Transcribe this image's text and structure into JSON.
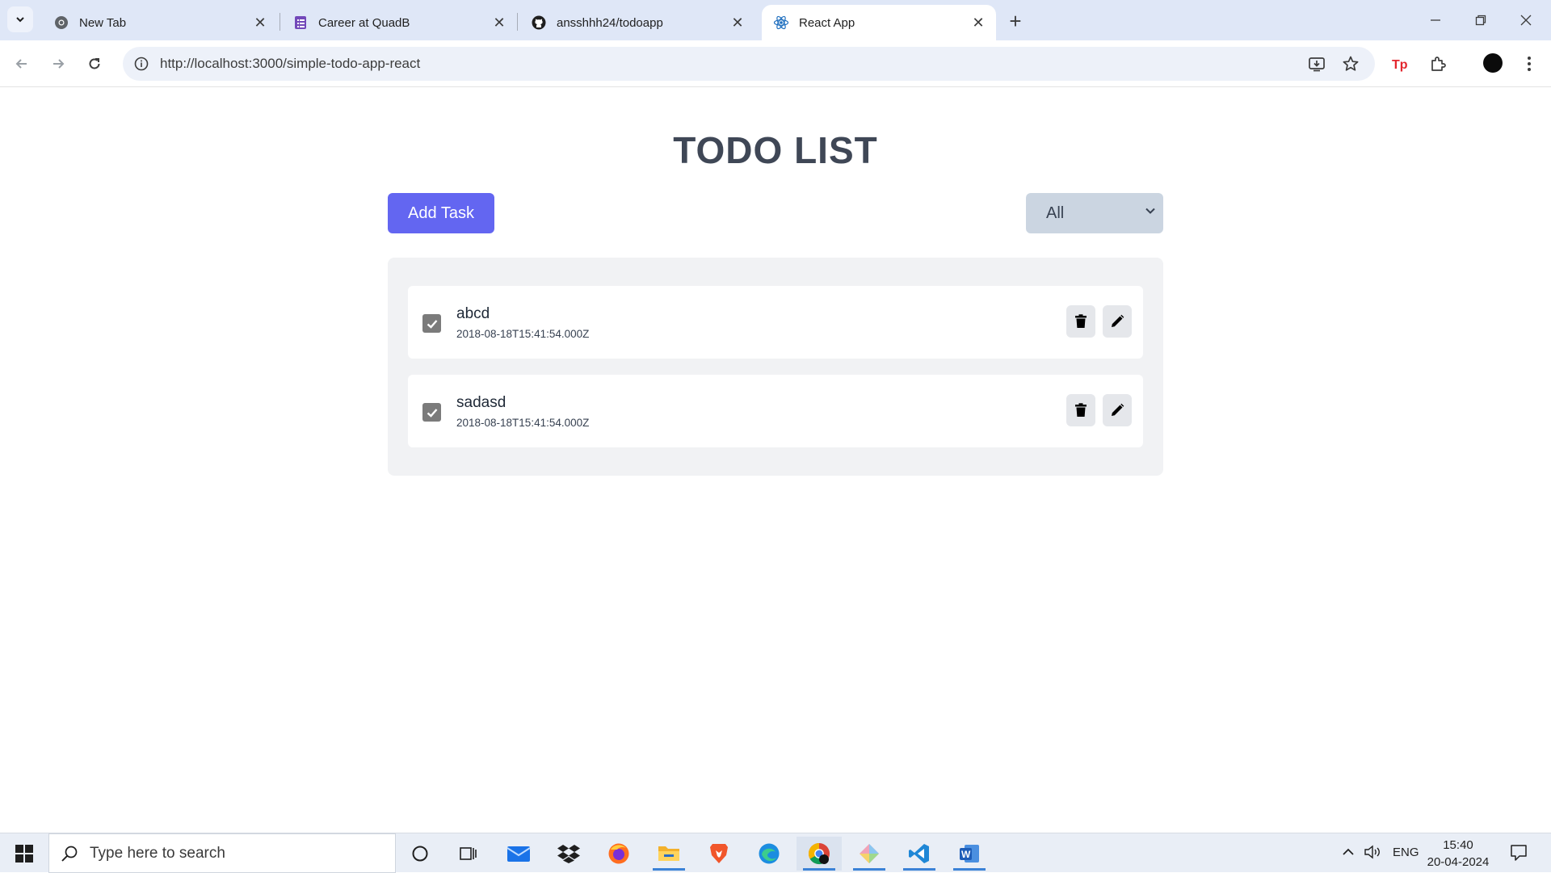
{
  "browser": {
    "tabs": [
      {
        "title": "New Tab",
        "favicon": "chrome-icon",
        "active": false
      },
      {
        "title": "Career at QuadB",
        "favicon": "forms-icon",
        "active": false
      },
      {
        "title": "ansshhh24/todoapp",
        "favicon": "github-icon",
        "active": false
      },
      {
        "title": "React App",
        "favicon": "react-icon",
        "active": true
      }
    ],
    "close_glyph": "✕",
    "new_tab_glyph": "+",
    "url": "http://localhost:3000/simple-todo-app-react",
    "window_controls": {
      "minimize": "—",
      "restore": "❐",
      "close": "✕"
    }
  },
  "app": {
    "heading": "TODO LIST",
    "add_task_label": "Add Task",
    "filter": {
      "selected": "All"
    },
    "todos": [
      {
        "title": "abcd",
        "timestamp": "2018-08-18T15:41:54.000Z",
        "completed": true
      },
      {
        "title": "sadasd",
        "timestamp": "2018-08-18T15:41:54.000Z",
        "completed": true
      }
    ]
  },
  "taskbar": {
    "search_placeholder": "Type here to search",
    "language": "ENG",
    "time": "15:40",
    "date": "20-04-2024"
  },
  "colors": {
    "primary_button": "#6366f1",
    "filter_bg": "#cbd5e1",
    "list_bg": "#f1f2f4",
    "heading": "#3f4756"
  }
}
